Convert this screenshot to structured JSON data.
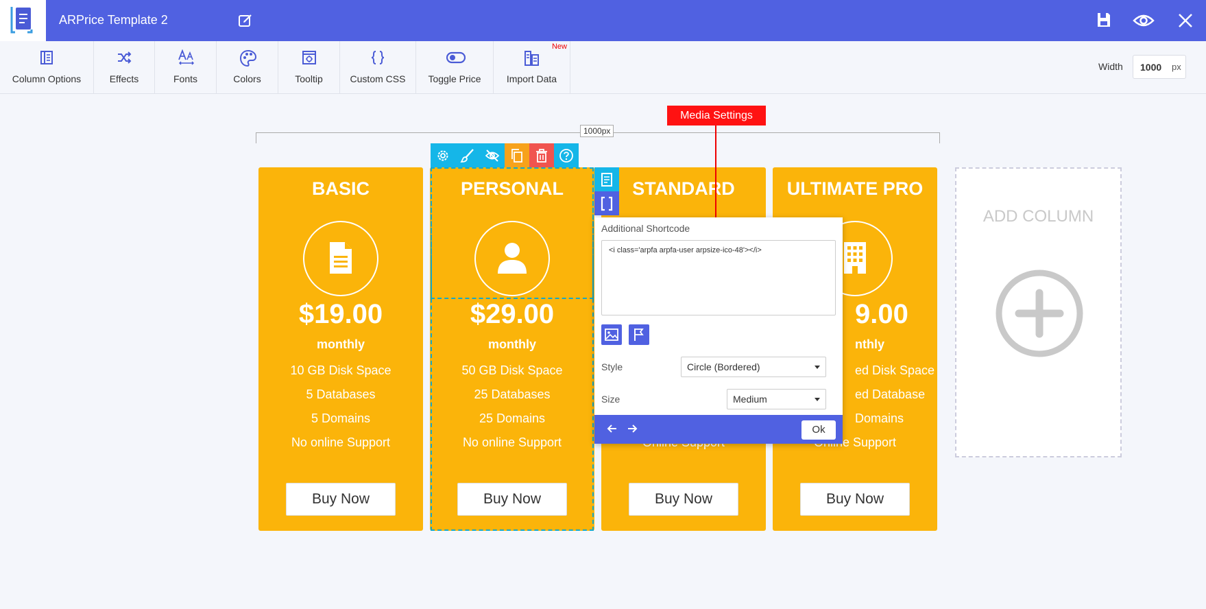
{
  "header": {
    "title": "ARPrice Template 2",
    "icons": [
      "logo-icon",
      "edit-icon",
      "save-icon",
      "preview-icon",
      "close-icon"
    ],
    "background": "#5061e1"
  },
  "toolbar": {
    "items": [
      {
        "label": "Column Options",
        "icon": "column-options-icon"
      },
      {
        "label": "Effects",
        "icon": "shuffle-icon"
      },
      {
        "label": "Fonts",
        "icon": "fonts-icon"
      },
      {
        "label": "Colors",
        "icon": "palette-icon"
      },
      {
        "label": "Tooltip",
        "icon": "tooltip-icon"
      },
      {
        "label": "Custom CSS",
        "icon": "braces-icon"
      },
      {
        "label": "Toggle Price",
        "icon": "toggle-icon"
      },
      {
        "label": "Import Data",
        "icon": "import-icon",
        "badge": "New"
      }
    ],
    "width_label": "Width",
    "width_value": "1000",
    "width_unit": "px"
  },
  "ruler": {
    "label": "1000px"
  },
  "callout": {
    "label": "Media Settings"
  },
  "columns": [
    {
      "title": "BASIC",
      "price": "$19.00",
      "period": "monthly",
      "features": [
        "10 GB Disk Space",
        "5 Databases",
        "5 Domains",
        "No online Support"
      ],
      "button": "Buy Now",
      "icon": "document-icon"
    },
    {
      "title": "PERSONAL",
      "price": "$29.00",
      "period": "monthly",
      "features": [
        "50 GB Disk Space",
        "25 Databases",
        "25 Domains",
        "No online Support"
      ],
      "button": "Buy Now",
      "icon": "user-icon"
    },
    {
      "title": "STANDARD",
      "price": "",
      "period": "",
      "features": [
        "",
        "",
        "",
        "Online Support"
      ],
      "button": "Buy Now",
      "icon": ""
    },
    {
      "title": "ULTIMATE PRO",
      "price": "9.00",
      "period": "nthly",
      "features": [
        "ed Disk Space",
        "ed Database",
        "Domains",
        "Online Support"
      ],
      "button": "Buy Now",
      "icon": "building-icon"
    }
  ],
  "add_column": {
    "label": "ADD COLUMN"
  },
  "popup": {
    "shortcode_label": "Additional Shortcode",
    "shortcode_value": "<i class='arpfa arpfa-user arpsize-ico-48'></i>",
    "style_label": "Style",
    "style_value": "Circle (Bordered)",
    "size_label": "Size",
    "size_value": "Medium",
    "ok_label": "Ok"
  },
  "colors": {
    "column": "#fbb40a",
    "accent": "#5061e1",
    "action_cyan": "#15b6e8",
    "action_orange": "#f7a21b",
    "action_red": "#f0544f",
    "callout": "#ff1212"
  }
}
